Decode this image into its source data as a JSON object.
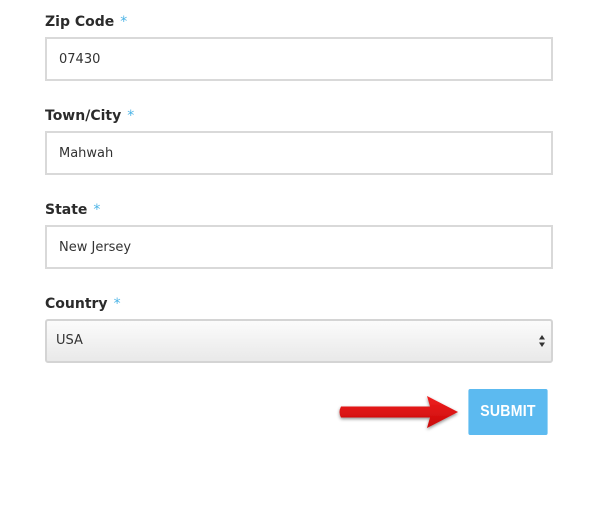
{
  "form": {
    "fields": [
      {
        "label": "Zip Code",
        "required_mark": "*",
        "value": "07430"
      },
      {
        "label": "Town/City",
        "required_mark": "*",
        "value": "Mahwah"
      },
      {
        "label": "State",
        "required_mark": "*",
        "value": "New Jersey"
      }
    ],
    "country": {
      "label": "Country",
      "required_mark": "*",
      "selected": "USA"
    },
    "submit_label": "SUBMIT"
  },
  "colors": {
    "required_mark": "#4ab3e6",
    "submit_background": "#5cbaf0",
    "annotation_arrow": "#e01010"
  },
  "icons": {
    "select_arrows": "updown-arrows-icon",
    "annotation": "red-arrow-icon"
  }
}
